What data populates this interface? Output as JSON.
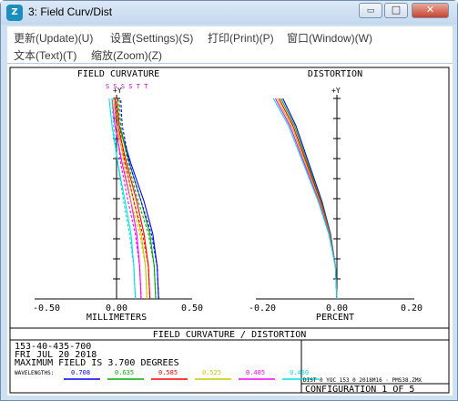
{
  "window": {
    "title": "3: Field Curv/Dist",
    "icon": "zemax-app-icon",
    "controls": {
      "minimize": "▭",
      "maximize": "□",
      "close": "✕"
    }
  },
  "menu": {
    "row1": [
      "更新(Update)(U)",
      "设置(Settings)(S)",
      "打印(Print)(P)",
      "窗口(Window)(W)"
    ],
    "row2": [
      "文本(Text)(T)",
      "缩放(Zoom)(Z)"
    ]
  },
  "plot": {
    "field_curvature": {
      "title": "FIELD CURVATURE",
      "legend_text": "S S S S T T",
      "axis_label": "+Y",
      "xlabel": "MILLIMETERS",
      "ticks": [
        "-0.50",
        "0.00",
        "0.50"
      ]
    },
    "distortion": {
      "title": "DISTORTION",
      "axis_label": "+Y",
      "xlabel": "PERCENT",
      "ticks": [
        "-0.20",
        "0.00",
        "0.20"
      ]
    },
    "footer": {
      "caption": "FIELD CURVATURE / DISTORTION",
      "lines": [
        "153-40-435-700",
        "FRI JUL 20 2018",
        "MAXIMUM FIELD IS 3.700 DEGREES"
      ],
      "wavelengths_label": "WAVELENGTHS:",
      "wavelengths": [
        {
          "value": "0.708",
          "color": "#0000ff"
        },
        {
          "value": "0.635",
          "color": "#00b000"
        },
        {
          "value": "0.585",
          "color": "#ff0000"
        },
        {
          "value": "0.525",
          "color": "#c8c800"
        },
        {
          "value": "0.485",
          "color": "#ff00ff"
        },
        {
          "value": "0.450",
          "color": "#00e0e0"
        }
      ],
      "file_info": "DIST  0  YOC 153  0  2018M16 · PMS38.ZMX",
      "configuration": "CONFIGURATION 1 OF 5"
    }
  },
  "chart_data": [
    {
      "type": "line",
      "title": "FIELD CURVATURE",
      "xlabel": "MILLIMETERS",
      "ylabel": "+Y",
      "xlim": [
        -0.5,
        0.5
      ],
      "ylim": [
        0,
        3.7
      ],
      "series": [
        {
          "name": "0.708 S",
          "color": "#0000ff",
          "x": [
            0.27,
            0.26,
            0.23,
            0.17,
            0.08,
            0.0,
            -0.02
          ],
          "y": [
            0,
            0.6,
            1.2,
            1.8,
            2.5,
            3.2,
            3.7
          ]
        },
        {
          "name": "0.635 S",
          "color": "#00b000",
          "x": [
            0.25,
            0.24,
            0.21,
            0.15,
            0.07,
            0.0,
            -0.02
          ],
          "y": [
            0,
            0.6,
            1.2,
            1.8,
            2.5,
            3.2,
            3.7
          ]
        },
        {
          "name": "0.585 S",
          "color": "#ff0000",
          "x": [
            0.21,
            0.2,
            0.17,
            0.12,
            0.05,
            -0.01,
            -0.03
          ],
          "y": [
            0,
            0.6,
            1.2,
            1.8,
            2.5,
            3.2,
            3.7
          ]
        },
        {
          "name": "0.525 S",
          "color": "#c8c800",
          "x": [
            0.19,
            0.18,
            0.15,
            0.1,
            0.04,
            -0.02,
            -0.04
          ],
          "y": [
            0,
            0.6,
            1.2,
            1.8,
            2.5,
            3.2,
            3.7
          ]
        },
        {
          "name": "0.485 S",
          "color": "#ff00ff",
          "x": [
            0.15,
            0.14,
            0.12,
            0.08,
            0.02,
            -0.03,
            -0.05
          ],
          "y": [
            0,
            0.6,
            1.2,
            1.8,
            2.5,
            3.2,
            3.7
          ]
        },
        {
          "name": "0.450 S",
          "color": "#00e0e0",
          "x": [
            0.11,
            0.1,
            0.08,
            0.04,
            -0.01,
            -0.05,
            -0.07
          ],
          "y": [
            0,
            0.6,
            1.2,
            1.8,
            2.5,
            3.2,
            3.7
          ]
        },
        {
          "name": "0.708 T",
          "color": "#0000ff",
          "x": [
            0.27,
            0.26,
            0.22,
            0.15,
            0.07,
            0.02,
            0.01
          ],
          "y": [
            0,
            0.6,
            1.2,
            1.8,
            2.5,
            3.2,
            3.7
          ]
        },
        {
          "name": "0.635 T",
          "color": "#00b000",
          "x": [
            0.25,
            0.24,
            0.2,
            0.13,
            0.06,
            0.01,
            0.0
          ],
          "y": [
            0,
            0.6,
            1.2,
            1.8,
            2.5,
            3.2,
            3.7
          ]
        },
        {
          "name": "0.585 T",
          "color": "#ff0000",
          "x": [
            0.21,
            0.2,
            0.16,
            0.1,
            0.04,
            0.0,
            -0.01
          ],
          "y": [
            0,
            0.6,
            1.2,
            1.8,
            2.5,
            3.2,
            3.7
          ]
        },
        {
          "name": "0.525 T",
          "color": "#c8c800",
          "x": [
            0.19,
            0.18,
            0.14,
            0.08,
            0.03,
            -0.01,
            -0.02
          ],
          "y": [
            0,
            0.6,
            1.2,
            1.8,
            2.5,
            3.2,
            3.7
          ]
        },
        {
          "name": "0.485 T",
          "color": "#ff00ff",
          "x": [
            0.15,
            0.14,
            0.11,
            0.06,
            0.01,
            -0.02,
            -0.03
          ],
          "y": [
            0,
            0.6,
            1.2,
            1.8,
            2.5,
            3.2,
            3.7
          ]
        },
        {
          "name": "0.450 T",
          "color": "#00e0e0",
          "x": [
            0.11,
            0.1,
            0.07,
            0.03,
            -0.01,
            -0.04,
            -0.05
          ],
          "y": [
            0,
            0.6,
            1.2,
            1.8,
            2.5,
            3.2,
            3.7
          ]
        }
      ]
    },
    {
      "type": "line",
      "title": "DISTORTION",
      "xlabel": "PERCENT",
      "ylabel": "+Y",
      "xlim": [
        -0.2,
        0.2
      ],
      "ylim": [
        0,
        3.7
      ],
      "series": [
        {
          "name": "0.708",
          "color": "#0000ff",
          "x": [
            0.0,
            -0.004,
            -0.017,
            -0.04,
            -0.075,
            -0.11,
            -0.145
          ],
          "y": [
            0,
            0.6,
            1.2,
            1.8,
            2.5,
            3.2,
            3.7
          ]
        },
        {
          "name": "0.635",
          "color": "#00b000",
          "x": [
            0.0,
            -0.004,
            -0.018,
            -0.042,
            -0.078,
            -0.114,
            -0.15
          ],
          "y": [
            0,
            0.6,
            1.2,
            1.8,
            2.5,
            3.2,
            3.7
          ]
        },
        {
          "name": "0.585",
          "color": "#ff0000",
          "x": [
            0.0,
            -0.004,
            -0.019,
            -0.044,
            -0.081,
            -0.118,
            -0.155
          ],
          "y": [
            0,
            0.6,
            1.2,
            1.8,
            2.5,
            3.2,
            3.7
          ]
        },
        {
          "name": "0.525",
          "color": "#c8c800",
          "x": [
            0.0,
            -0.004,
            -0.02,
            -0.046,
            -0.084,
            -0.122,
            -0.16
          ],
          "y": [
            0,
            0.6,
            1.2,
            1.8,
            2.5,
            3.2,
            3.7
          ]
        },
        {
          "name": "0.485",
          "color": "#ff00ff",
          "x": [
            0.0,
            -0.004,
            -0.021,
            -0.048,
            -0.087,
            -0.126,
            -0.165
          ],
          "y": [
            0,
            0.6,
            1.2,
            1.8,
            2.5,
            3.2,
            3.7
          ]
        },
        {
          "name": "0.450",
          "color": "#00e0e0",
          "x": [
            0.0,
            -0.004,
            -0.022,
            -0.05,
            -0.09,
            -0.13,
            -0.17
          ],
          "y": [
            0,
            0.6,
            1.2,
            1.8,
            2.5,
            3.2,
            3.7
          ]
        }
      ]
    }
  ]
}
